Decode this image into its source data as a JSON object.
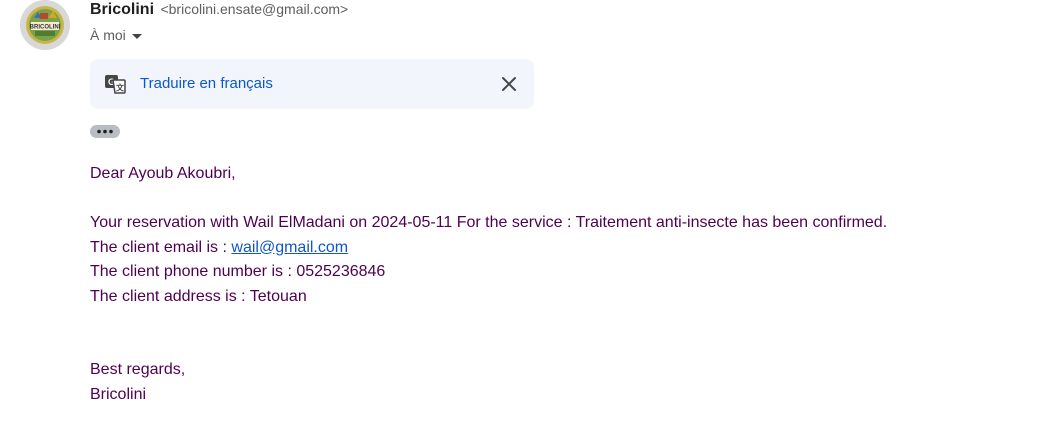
{
  "sender": {
    "name": "Bricolini",
    "email": "<bricolini.ensate@gmail.com>",
    "avatar_text": "BRICOLINI"
  },
  "recipient": {
    "label": "À moi"
  },
  "translate": {
    "link_label": "Traduire en français"
  },
  "body": {
    "greeting": "Dear Ayoub Akoubri,",
    "line1": "Your reservation with Wail ElMadani on 2024-05-11 For the service : Traitement anti-insecte has been confirmed.",
    "email_prefix": "The client email is : ",
    "email_link": "wail@gmail.com",
    "phone_line": "The client phone number is : 0525236846",
    "address_line": "The client address is : Tetouan",
    "closing": "Best regards,",
    "signature": "Bricolini"
  },
  "colors": {
    "body_text": "#500050",
    "link": "#1155cc",
    "translate_link": "#0b57d0",
    "translate_bg": "#f2f6fc"
  }
}
